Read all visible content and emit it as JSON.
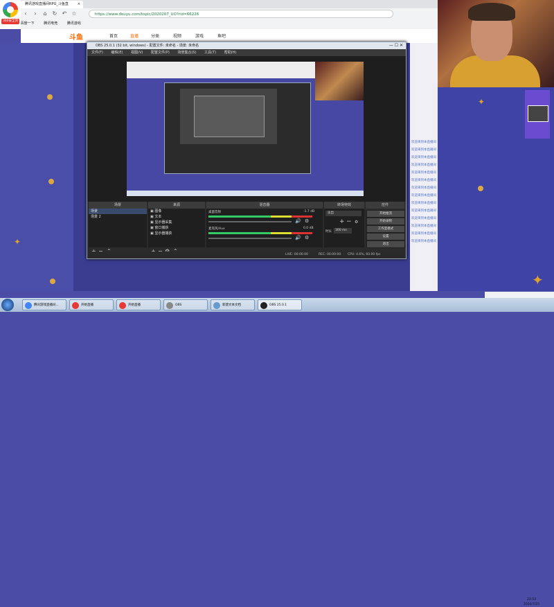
{
  "browser": {
    "tab_title": "腾讯游戏直播间RPG_斗鱼直",
    "url": "https://www.douyu.com/topic/2020207_UO?rid=66226",
    "bookmarks": [
      "百度",
      "百度一下",
      "腾讯电竞",
      "腾讯游戏"
    ],
    "sidebar_label": "360安全浏览"
  },
  "site": {
    "logo": "斗鱼",
    "nav": [
      "首页",
      "直播",
      "分类",
      "视频",
      "游戏",
      "鱼吧"
    ],
    "chat": [
      "欢迎来到本直播间",
      "欢迎来到本直播间",
      "欢迎来到本直播间",
      "欢迎来到本直播间",
      "欢迎来到本直播间",
      "欢迎来到本直播间",
      "欢迎来到本直播间",
      "欢迎来到本直播间",
      "欢迎来到本直播间",
      "欢迎来到本直播间",
      "欢迎来到本直播间",
      "欢迎来到本直播间",
      "欢迎来到本直播间",
      "欢迎来到本直播间"
    ]
  },
  "obs": {
    "title": "OBS 25.0.1 (32 bit, windows) - 配置文件: 未命名 - 场景: 未命名",
    "menu": [
      "文件(F)",
      "编辑(E)",
      "视图(V)",
      "配置文件(P)",
      "场景集合(S)",
      "工具(T)",
      "帮助(H)"
    ],
    "dock_titles": [
      "场景",
      "来源",
      "混音器",
      "转场特效",
      "控件"
    ],
    "scenes": [
      "场景",
      "场景 2"
    ],
    "sources": [
      "图像",
      "文本",
      "显示器采集",
      "窗口捕获",
      "显示器捕获"
    ],
    "mixer": [
      {
        "label": "桌面音频",
        "db": "-1.7 dB"
      },
      {
        "label": "麦克风/Aux",
        "db": "0.0 dB"
      }
    ],
    "transition": {
      "type": "淡出",
      "duration_label": "时长",
      "duration": "300 ms"
    },
    "controls": [
      "开始推流",
      "开始录制",
      "工作室模式",
      "设置",
      "退出"
    ],
    "status": {
      "live": "LIVE: 00:00:00",
      "rec": "REC: 00:00:00",
      "cpu": "CPU: 4.6%, 60.00 fps"
    }
  },
  "taskbar": {
    "items": [
      "腾讯游戏直播间...",
      "开始直播",
      "开始直播",
      "OBS",
      "新建文本文档",
      "OBS 25.0.1"
    ],
    "time": "22:53",
    "date": "2020/7/25"
  },
  "colors": {
    "site_bg": "#4b4ea9",
    "obs_bg": "#2b2b2b",
    "accent": "#ff6a00"
  }
}
